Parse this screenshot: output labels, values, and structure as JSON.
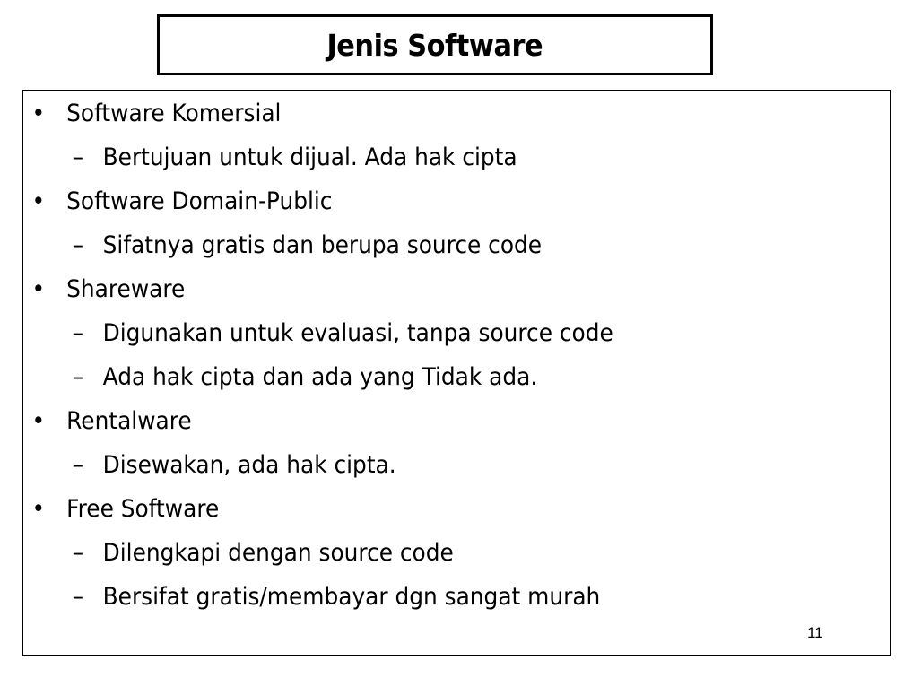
{
  "title": "Jenis Software",
  "bullet_glyph": "•",
  "dash_glyph": "–",
  "items": [
    {
      "label": "Software Komersial",
      "subs": [
        "Bertujuan untuk dijual. Ada hak cipta"
      ]
    },
    {
      "label": "Software Domain-Public",
      "subs": [
        "Sifatnya gratis dan berupa source code"
      ]
    },
    {
      "label": "Shareware",
      "subs": [
        "Digunakan untuk evaluasi, tanpa source code",
        "Ada hak cipta dan ada yang Tidak ada."
      ]
    },
    {
      "label": "Rentalware",
      "subs": [
        "Disewakan, ada hak cipta."
      ]
    },
    {
      "label": "Free Software",
      "subs": [
        "Dilengkapi dengan source code",
        "Bersifat gratis/membayar dgn sangat murah"
      ]
    }
  ],
  "page_number": "11"
}
